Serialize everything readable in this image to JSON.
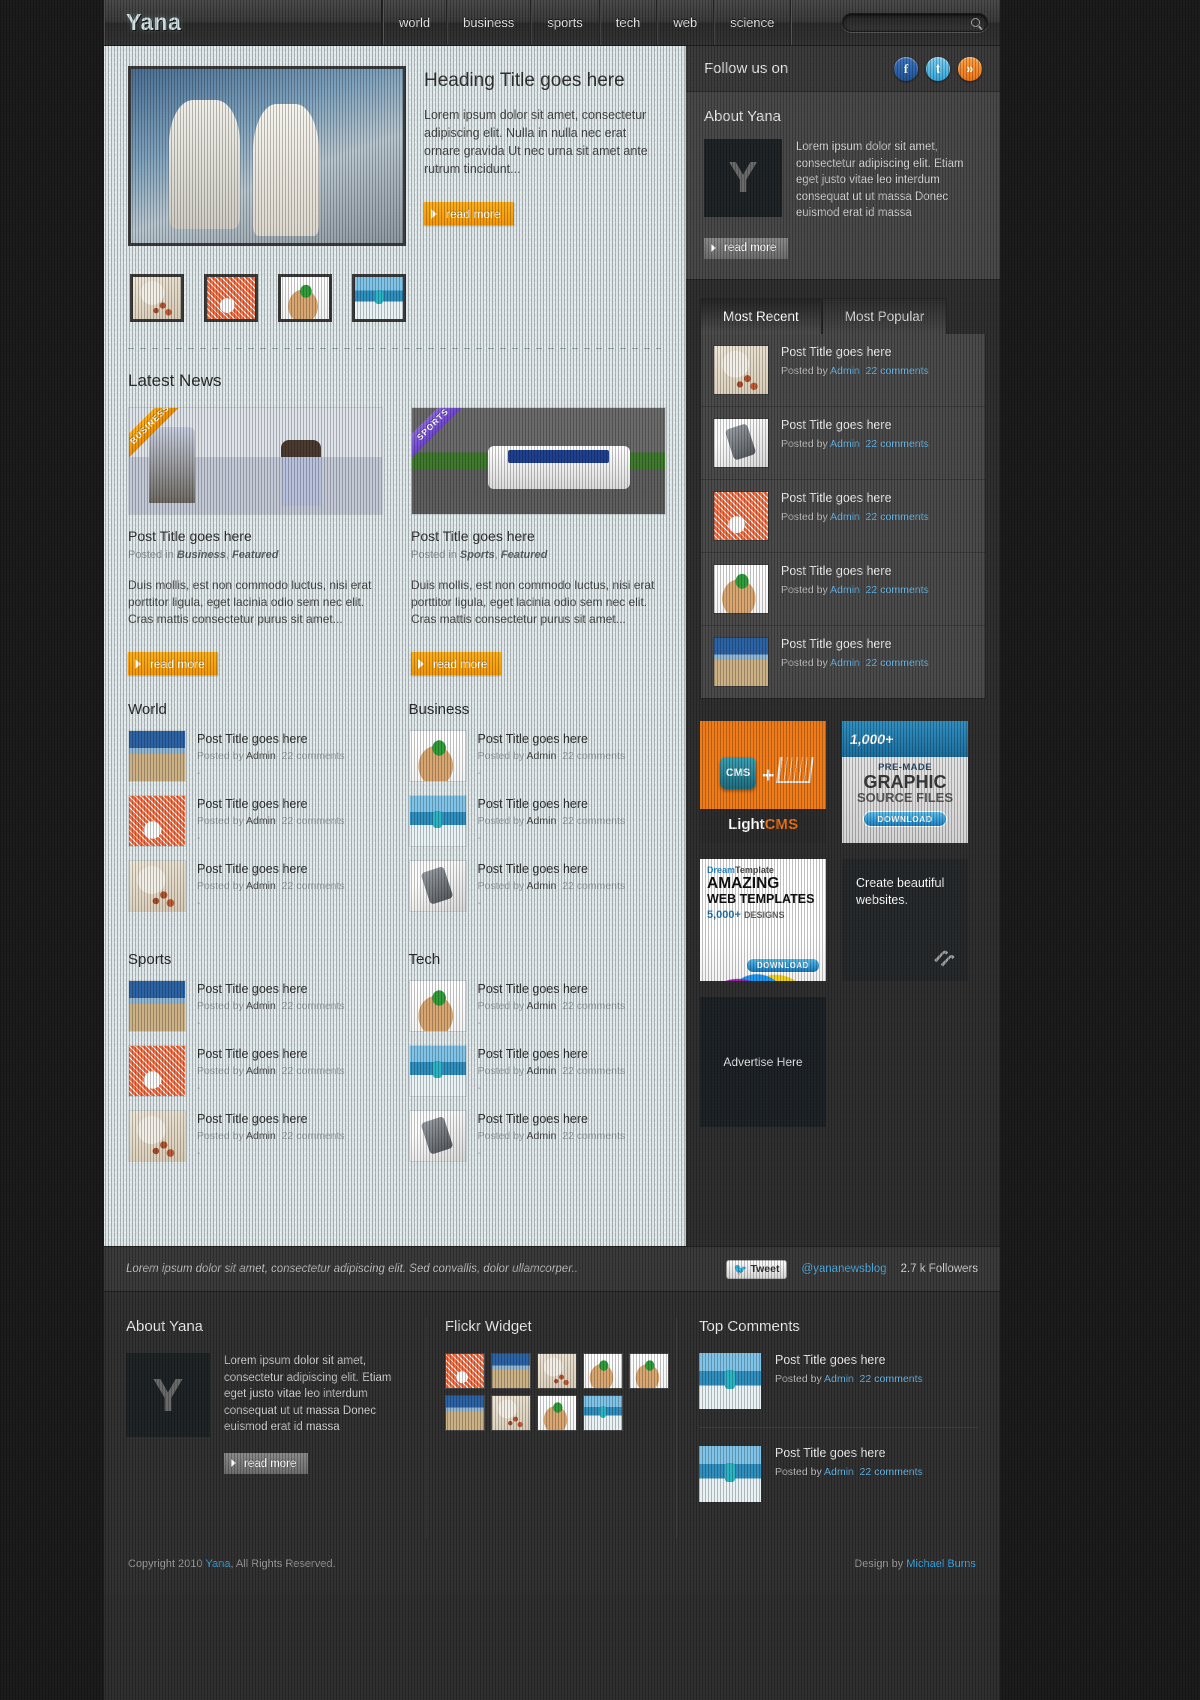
{
  "site": {
    "logo": "Yana"
  },
  "nav": {
    "items": [
      "world",
      "business",
      "sports",
      "tech",
      "web",
      "science"
    ]
  },
  "search": {
    "placeholder": "",
    "value": ""
  },
  "featured": {
    "heading": "Heading Title goes here",
    "text": "Lorem ipsum dolor sit amet, consectetur adipiscing elit. Nulla in nulla nec erat ornare gravida Ut nec urna sit amet ante rutrum tincidunt...",
    "read_more": "read more",
    "thumbs": [
      "beans",
      "ball",
      "plant",
      "surf"
    ]
  },
  "latest_news": {
    "title": "Latest News",
    "posts": [
      {
        "ribbon": "BUSINESS",
        "image": "office",
        "title": "Post Title goes here",
        "meta_prefix": "Posted in",
        "meta_cat": "Business",
        "meta_cat2": "Featured",
        "excerpt": "Duis mollis, est non commodo luctus, nisi erat porttitor ligula, eget lacinia odio sem nec elit. Cras mattis consectetur purus sit amet...",
        "read_more": "read more"
      },
      {
        "ribbon": "SPORTS",
        "image": "f1",
        "title": "Post Title goes here",
        "meta_prefix": "Posted in",
        "meta_cat": "Sports",
        "meta_cat2": "Featured",
        "excerpt": "Duis mollis, est non commodo luctus, nisi erat porttitor ligula, eget lacinia odio sem nec elit. Cras mattis consectetur purus sit amet...",
        "read_more": "read more"
      }
    ]
  },
  "categories": [
    {
      "name": "World",
      "items": [
        {
          "title": "Post Title goes here",
          "posted_by": "Posted by",
          "author": "Admin",
          "comments": "22 comments",
          "dash": "-",
          "image": "beach"
        },
        {
          "title": "Post Title goes here",
          "posted_by": "Posted by",
          "author": "Admin",
          "comments": "22 comments",
          "dash": "-",
          "image": "ball"
        },
        {
          "title": "Post Title goes here",
          "posted_by": "Posted by",
          "author": "Admin",
          "comments": "22 comments",
          "dash": "-",
          "image": "beans"
        }
      ]
    },
    {
      "name": "Business",
      "items": [
        {
          "title": "Post Title goes here",
          "posted_by": "Posted by",
          "author": "Admin",
          "comments": "22 comments",
          "dash": "-",
          "image": "plant"
        },
        {
          "title": "Post Title goes here",
          "posted_by": "Posted by",
          "author": "Admin",
          "comments": "22 comments",
          "dash": "-",
          "image": "surf"
        },
        {
          "title": "Post Title goes here",
          "posted_by": "Posted by",
          "author": "Admin",
          "comments": "22 comments",
          "dash": "-",
          "image": "phone"
        }
      ]
    },
    {
      "name": "Sports",
      "items": [
        {
          "title": "Post Title goes here",
          "posted_by": "Posted by",
          "author": "Admin",
          "comments": "22 comments",
          "dash": "-",
          "image": "beach"
        },
        {
          "title": "Post Title goes here",
          "posted_by": "Posted by",
          "author": "Admin",
          "comments": "22 comments",
          "dash": "-",
          "image": "ball"
        },
        {
          "title": "Post Title goes here",
          "posted_by": "Posted by",
          "author": "Admin",
          "comments": "22 comments",
          "dash": "-",
          "image": "beans"
        }
      ]
    },
    {
      "name": "Tech",
      "items": [
        {
          "title": "Post Title goes here",
          "posted_by": "Posted by",
          "author": "Admin",
          "comments": "22 comments",
          "dash": "-",
          "image": "plant"
        },
        {
          "title": "Post Title goes here",
          "posted_by": "Posted by",
          "author": "Admin",
          "comments": "22 comments",
          "dash": "-",
          "image": "surf"
        },
        {
          "title": "Post Title goes here",
          "posted_by": "Posted by",
          "author": "Admin",
          "comments": "22 comments",
          "dash": "-",
          "image": "phone"
        }
      ]
    }
  ],
  "sidebar": {
    "follow": {
      "title": "Follow us on",
      "icons": [
        "facebook-icon",
        "twitter-icon",
        "rss-icon"
      ],
      "fb_glyph": "f",
      "tw_glyph": "t",
      "rss_glyph": "»"
    },
    "about": {
      "title": "About Yana",
      "logo_letter": "Y",
      "text": "Lorem ipsum dolor sit amet, consectetur adipiscing elit. Etiam eget justo vitae leo interdum consequat ut ut massa Donec euismod erat id massa",
      "read_more": "read more"
    },
    "tabs": [
      {
        "label": "Most Recent",
        "active": true
      },
      {
        "label": "Most Popular",
        "active": false
      }
    ],
    "tab_items": [
      {
        "title": "Post Title goes here",
        "posted_by": "Posted by",
        "author": "Admin",
        "comments": "22 comments",
        "image": "beans"
      },
      {
        "title": "Post Title goes here",
        "posted_by": "Posted by",
        "author": "Admin",
        "comments": "22 comments",
        "image": "phone"
      },
      {
        "title": "Post Title goes here",
        "posted_by": "Posted by",
        "author": "Admin",
        "comments": "22 comments",
        "image": "ball"
      },
      {
        "title": "Post Title goes here",
        "posted_by": "Posted by",
        "author": "Admin",
        "comments": "22 comments",
        "image": "plant"
      },
      {
        "title": "Post Title goes here",
        "posted_by": "Posted by",
        "author": "Admin",
        "comments": "22 comments",
        "image": "beach"
      }
    ],
    "ads": {
      "lightcms": {
        "badge": "CMS",
        "plus": "+",
        "brand_light": "Light",
        "brand_cms": "CMS"
      },
      "graphic": {
        "count": "1,000+",
        "l1": "PRE-MADE",
        "l2": "GRAPHIC",
        "l3": "SOURCE FILES",
        "button": "DOWNLOAD"
      },
      "dream": {
        "brand1": "Dream",
        "brand2": "Template",
        "sup": "®",
        "l1": "AMAZING",
        "l2": "WEB TEMPLATES",
        "l3": "5,000+",
        "l3b": "DESIGNS",
        "button": "DOWNLOAD"
      },
      "square": {
        "text": "Create beautiful websites."
      },
      "advertise": {
        "text": "Advertise Here"
      }
    }
  },
  "twitter_bar": {
    "tweet_text": "Lorem ipsum dolor sit amet, consectetur adipiscing elit. Sed convallis, dolor ullamcorper..",
    "tweet_button": "Tweet",
    "handle": "@yananewsblog",
    "followers": "2.7 k Followers"
  },
  "footer": {
    "about": {
      "title": "About Yana",
      "logo_letter": "Y",
      "text": "Lorem ipsum dolor sit amet, consectetur adipiscing elit. Etiam eget justo vitae leo interdum consequat ut ut massa Donec euismod erat id massa",
      "read_more": "read more"
    },
    "flickr": {
      "title": "Flickr Widget",
      "thumbs": [
        "ball",
        "beach",
        "beans",
        "plant",
        "plant",
        "beach",
        "beans",
        "plant",
        "surf"
      ]
    },
    "top_comments": {
      "title": "Top Comments",
      "items": [
        {
          "title": "Post Title goes here",
          "posted_by": "Posted by",
          "author": "Admin",
          "comments": "22 comments",
          "image": "surf"
        },
        {
          "title": "Post Title goes here",
          "posted_by": "Posted by",
          "author": "Admin",
          "comments": "22 comments",
          "image": "surf"
        }
      ]
    },
    "copyright_pre": "Copyright 2010",
    "copyright_link": "Yana",
    "copyright_post": ", All Rights Reserved.",
    "design_pre": "Design by",
    "design_link": "Michael Burns"
  },
  "colors": {
    "accent_orange": "#f59806",
    "link_blue": "#3aa8e8",
    "page_dark": "#2f2f2f",
    "content_bg": "#dde6e8"
  }
}
